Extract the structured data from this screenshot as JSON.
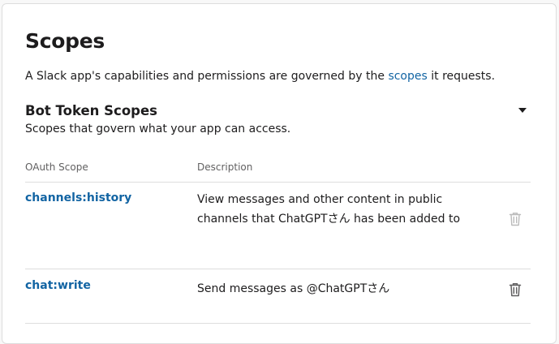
{
  "section": {
    "title": "Scopes",
    "intro_before": "A Slack app's capabilities and permissions are governed by the ",
    "intro_link": "scopes",
    "intro_after": " it requests."
  },
  "bot_scopes": {
    "title": "Bot Token Scopes",
    "subtitle": "Scopes that govern what your app can access.",
    "toggle_icon": "caret-down-icon",
    "columns": {
      "scope": "OAuth Scope",
      "description": "Description"
    },
    "rows": [
      {
        "scope": "channels:history",
        "description": "View messages and other content in public channels that ChatGPTさん has been added to",
        "delete_icon": "trash-icon",
        "delete_enabled": false
      },
      {
        "scope": "chat:write",
        "description": "Send messages as @ChatGPTさん",
        "delete_icon": "trash-icon",
        "delete_enabled": true
      }
    ]
  },
  "colors": {
    "link": "#1264a3",
    "text": "#1d1c1d",
    "muted": "#616061",
    "divider": "#dddddd",
    "icon_disabled": "#bbbbbb",
    "icon_enabled": "#616061"
  }
}
